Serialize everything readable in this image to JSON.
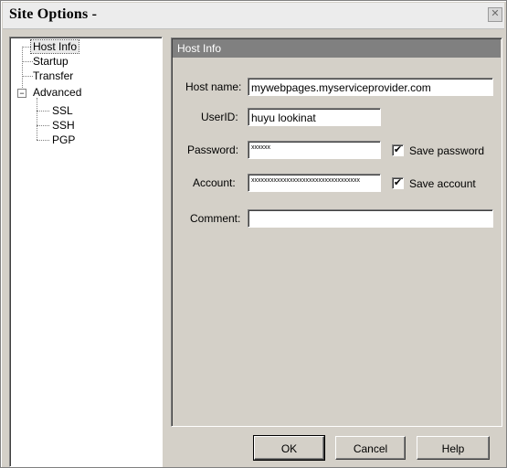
{
  "window": {
    "title": "Site Options -",
    "close_glyph": "✕"
  },
  "tree": {
    "items": [
      {
        "label": "Host Info"
      },
      {
        "label": "Startup"
      },
      {
        "label": "Transfer"
      },
      {
        "label": "Advanced",
        "expander": "−"
      },
      {
        "label": "SSL"
      },
      {
        "label": "SSH"
      },
      {
        "label": "PGP"
      }
    ]
  },
  "panel": {
    "header": "Host Info",
    "host_name": {
      "label": "Host name:",
      "value": "mywebpages.myserviceprovider.com"
    },
    "userid": {
      "label": "UserID:",
      "value": "huyu lookinat"
    },
    "password": {
      "label": "Password:",
      "value": "xxxxxx"
    },
    "account": {
      "label": "Account:",
      "value": "xxxxxxxxxxxxxxxxxxxxxxxxxxxxxxxxxx"
    },
    "comment": {
      "label": "Comment:",
      "value": ""
    },
    "save_password": {
      "label": "Save password",
      "checked": true,
      "mark": "✔"
    },
    "save_account": {
      "label": "Save account",
      "checked": true,
      "mark": "✔"
    }
  },
  "buttons": {
    "ok": "OK",
    "cancel": "Cancel",
    "help": "Help"
  }
}
